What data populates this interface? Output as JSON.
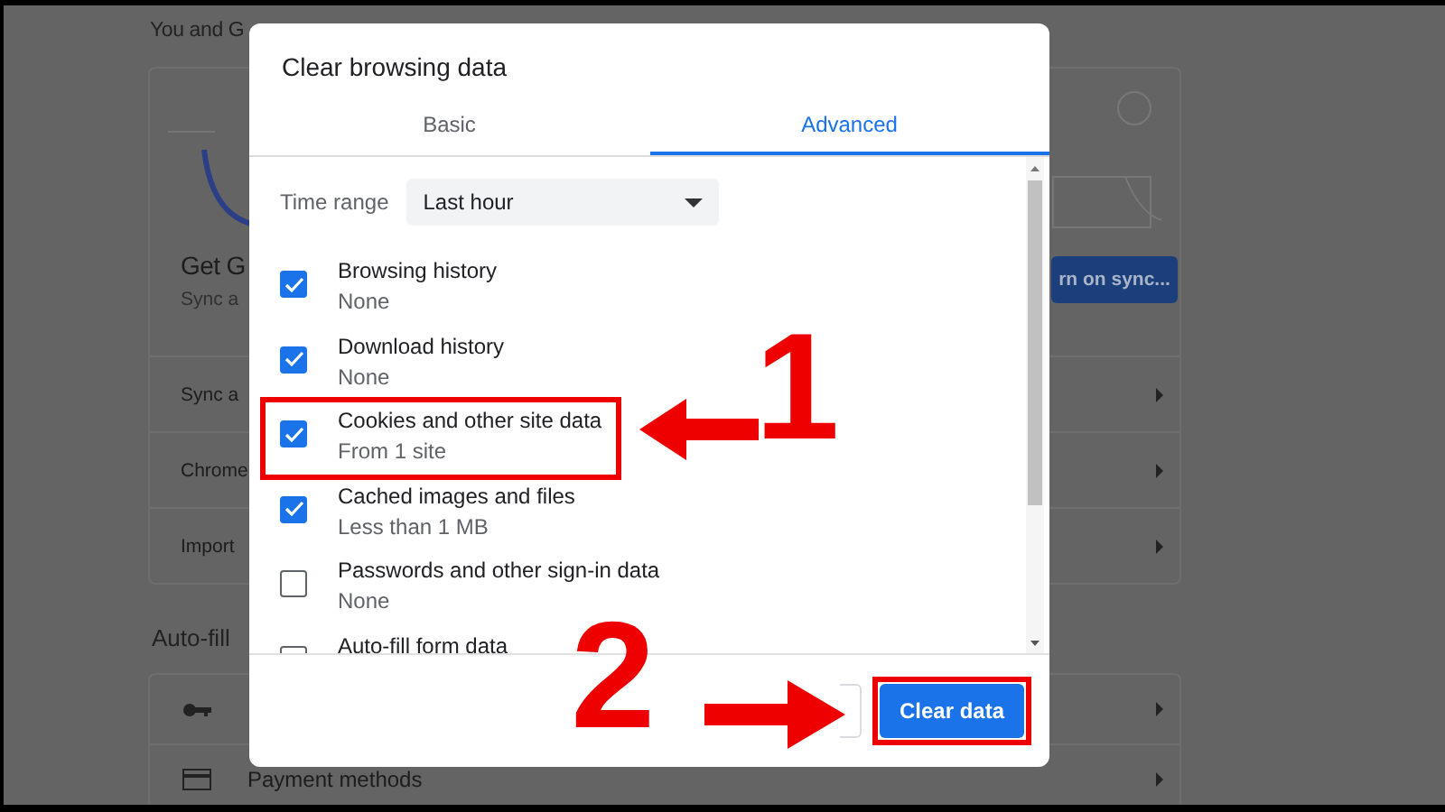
{
  "settings_page": {
    "section_title": "You and G",
    "card": {
      "heading": "Get G",
      "subtext": "Sync a",
      "sync_button": "rn on sync...",
      "rows": [
        "Sync a",
        "Chrome",
        "Import"
      ]
    },
    "autofill": {
      "title": "Auto-fill",
      "rows": [
        {
          "kind": "key"
        },
        {
          "kind": "card",
          "label": "Payment methods"
        }
      ]
    }
  },
  "dialog": {
    "title": "Clear browsing data",
    "tabs": [
      {
        "label": "Basic",
        "selected": false
      },
      {
        "label": "Advanced",
        "selected": true
      }
    ],
    "time_range": {
      "label": "Time range",
      "value": "Last hour"
    },
    "items": [
      {
        "label": "Browsing history",
        "detail": "None",
        "checked": true,
        "highlighted": false
      },
      {
        "label": "Download history",
        "detail": "None",
        "checked": true,
        "highlighted": false
      },
      {
        "label": "Cookies and other site data",
        "detail": "From 1 site",
        "checked": true,
        "highlighted": true
      },
      {
        "label": "Cached images and files",
        "detail": "Less than 1 MB",
        "checked": true,
        "highlighted": false
      },
      {
        "label": "Passwords and other sign-in data",
        "detail": "None",
        "checked": false,
        "highlighted": false
      },
      {
        "label": "Auto-fill form data",
        "checked": false,
        "highlighted": false
      }
    ],
    "buttons": [
      {
        "kind": "secondary",
        "highlighted": false
      },
      {
        "kind": "primary",
        "label": "Clear data",
        "highlighted": true
      }
    ]
  },
  "annotations": [
    {
      "number": "1",
      "kind": "left-arrow"
    },
    {
      "number": "2",
      "kind": "right-arrow"
    }
  ]
}
